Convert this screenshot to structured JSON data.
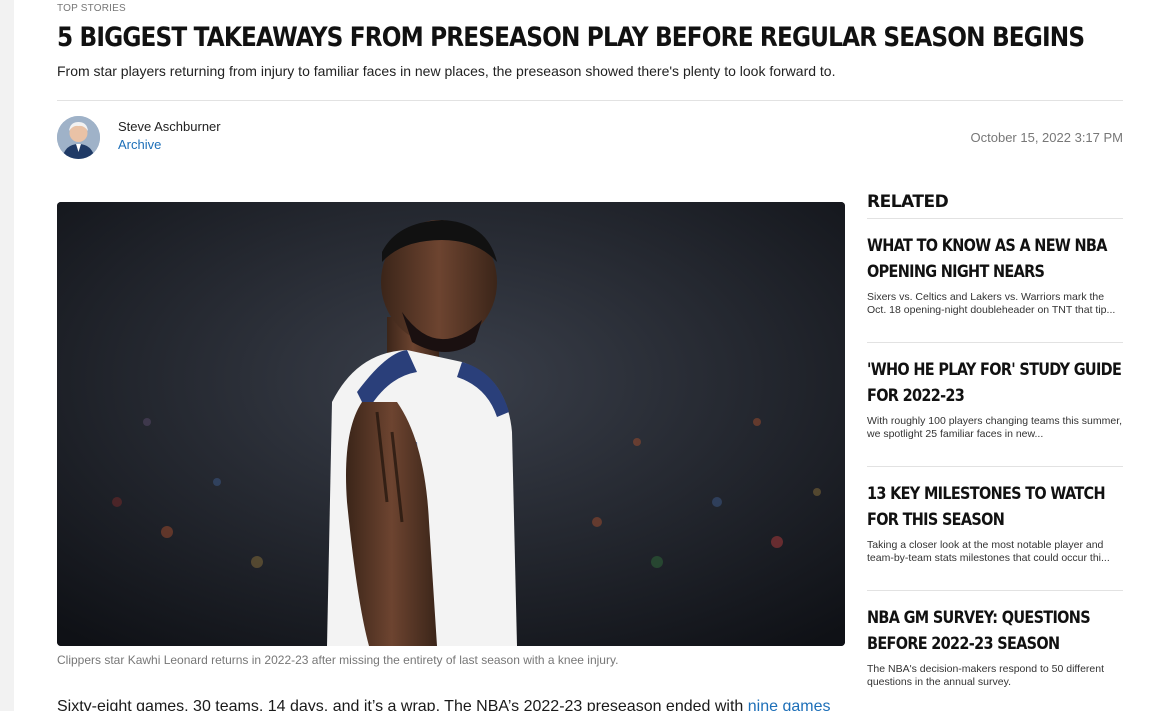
{
  "article": {
    "kicker": "TOP STORIES",
    "headline": "5 BIGGEST TAKEAWAYS FROM PRESEASON PLAY BEFORE REGULAR SEASON BEGINS",
    "subhead": "From star players returning from injury to familiar faces in new places, the preseason showed there's plenty to look forward to.",
    "author": "Steve Aschburner",
    "author_link": "Archive",
    "date": "October 15, 2022 3:17 PM",
    "caption": "Clippers star Kawhi Leonard returns in 2022-23 after missing the entirety of last season with a knee injury.",
    "body_start": "Sixty-eight games, 30 teams, 14 days, and it’s a wrap. The NBA’s 2022-23 preseason ended with ",
    "body_link": "nine games"
  },
  "related": {
    "title": "RELATED",
    "items": [
      {
        "headline": "WHAT TO KNOW AS A NEW NBA OPENING NIGHT NEARS",
        "desc": "Sixers vs. Celtics and Lakers vs. Warriors mark the Oct. 18 opening-night doubleheader on TNT that tip..."
      },
      {
        "headline": "'WHO HE PLAY FOR' STUDY GUIDE FOR 2022-23",
        "desc": "With roughly 100 players changing teams this summer, we spotlight 25 familiar faces in new..."
      },
      {
        "headline": "13 KEY MILESTONES TO WATCH FOR THIS SEASON",
        "desc": "Taking a closer look at the most notable player and team-by-team stats milestones that could occur thi..."
      },
      {
        "headline": "NBA GM SURVEY: QUESTIONS BEFORE 2022-23 SEASON",
        "desc": "The NBA's decision-makers respond to 50 different questions in the annual survey."
      }
    ]
  },
  "colors": {
    "link": "#1d6fb8",
    "muted": "#777777",
    "divider": "#e2e2e2"
  }
}
